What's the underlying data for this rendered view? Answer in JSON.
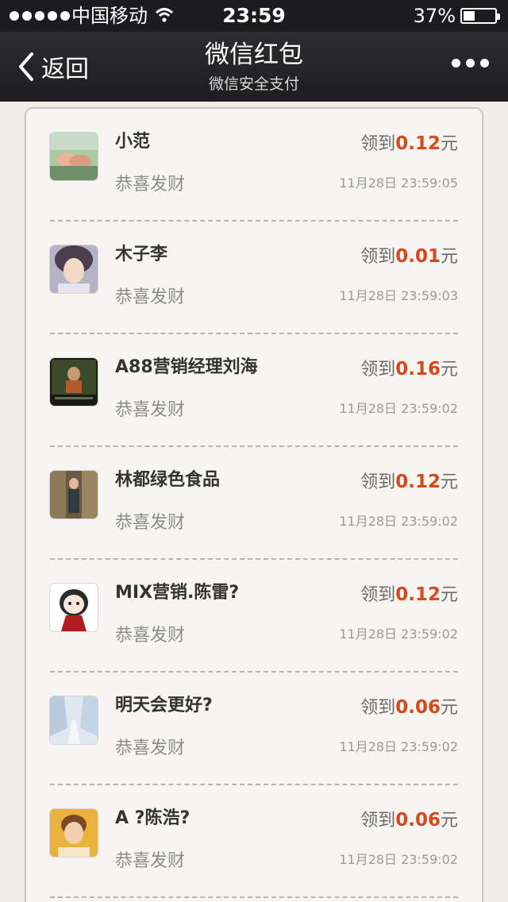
{
  "status_bar": {
    "carrier": "中国移动",
    "time": "23:59",
    "battery_percent_text": "37%",
    "battery_level": 0.37
  },
  "nav": {
    "back_label": "返回",
    "title": "微信红包",
    "subtitle": "微信安全支付"
  },
  "records": [
    {
      "name": "小范",
      "prefix": "领到",
      "amount": "0.12",
      "unit": "元",
      "blessing": "恭喜发财",
      "time": "11月28日 23:59:05",
      "avatar": "hands-photo"
    },
    {
      "name": "木子李",
      "prefix": "领到",
      "amount": "0.01",
      "unit": "元",
      "blessing": "恭喜发财",
      "time": "11月28日 23:59:03",
      "avatar": "portrait-photo"
    },
    {
      "name": "A88营销经理刘海",
      "prefix": "领到",
      "amount": "0.16",
      "unit": "元",
      "blessing": "恭喜发财",
      "time": "11月28日 23:59:02",
      "avatar": "dark-photo"
    },
    {
      "name": "林都绿色食品",
      "prefix": "领到",
      "amount": "0.12",
      "unit": "元",
      "blessing": "恭喜发财",
      "time": "11月28日 23:59:02",
      "avatar": "shop-photo"
    },
    {
      "name": "MIX营销.陈雷?",
      "prefix": "领到",
      "amount": "0.12",
      "unit": "元",
      "blessing": "恭喜发财",
      "time": "11月28日 23:59:02",
      "avatar": "cartoon-girl"
    },
    {
      "name": "明天会更好?",
      "prefix": "领到",
      "amount": "0.06",
      "unit": "元",
      "blessing": "恭喜发财",
      "time": "11月28日 23:59:02",
      "avatar": "snow-trees"
    },
    {
      "name": "A ?陈浩?",
      "prefix": "领到",
      "amount": "0.06",
      "unit": "元",
      "blessing": "恭喜发财",
      "time": "11月28日 23:59:02",
      "avatar": "boy-photo"
    }
  ],
  "colors": {
    "amount": "#d9481b",
    "nav_bg": "#1e1e20",
    "page_bg": "#efeee9"
  }
}
